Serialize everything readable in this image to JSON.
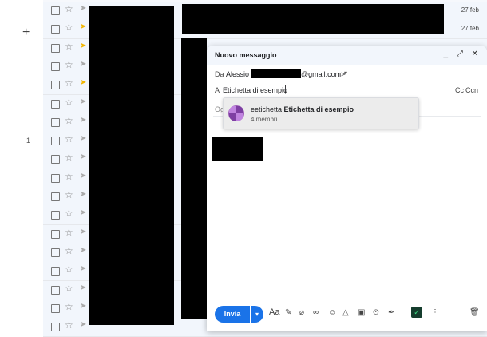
{
  "leftnav": {
    "compose_icon": "+",
    "count": "1"
  },
  "rows": [
    {
      "imp": false,
      "date": "27 feb"
    },
    {
      "imp": true,
      "date": "27 feb"
    },
    {
      "imp": true,
      "date": ""
    },
    {
      "imp": false,
      "date": ""
    },
    {
      "imp": true,
      "date": ""
    },
    {
      "imp": false,
      "date": ""
    },
    {
      "imp": false,
      "date": ""
    },
    {
      "imp": false,
      "date": ""
    },
    {
      "imp": false,
      "date": ""
    },
    {
      "imp": false,
      "date": ""
    },
    {
      "imp": false,
      "date": ""
    },
    {
      "imp": false,
      "date": ""
    },
    {
      "imp": false,
      "date": ""
    },
    {
      "imp": false,
      "date": ""
    },
    {
      "imp": false,
      "date": ""
    },
    {
      "imp": false,
      "date": ""
    },
    {
      "imp": false,
      "date": ""
    },
    {
      "imp": false,
      "date": ""
    }
  ],
  "compose": {
    "title": "Nuovo messaggio",
    "minimize": "_",
    "expand": "⤢",
    "close": "✕",
    "from_label": "Da",
    "from_name": "Alessio <",
    "from_domain": "@gmail.com>",
    "to_label": "A",
    "to_value": "Etichetta di esempio",
    "cc": "Cc",
    "bcc": "Ccn",
    "subject_placeholder": "Og",
    "suggestion": {
      "prefix": "eetichetta ",
      "name": "Etichetta di esempio",
      "members": "4 membri"
    },
    "send": "Invia",
    "send_options": "▾",
    "format_label": "Aa"
  },
  "colors": {
    "accent": "#1a73e8",
    "important": "#f2b600",
    "avatar": "#9b59b6"
  },
  "icons": [
    "ai-pen-icon",
    "attach-icon",
    "link-icon",
    "emoji-icon",
    "drive-icon",
    "photo-icon",
    "lock-timer-icon",
    "signature-icon",
    "grammarly-icon",
    "more-icon",
    "trash-icon"
  ]
}
